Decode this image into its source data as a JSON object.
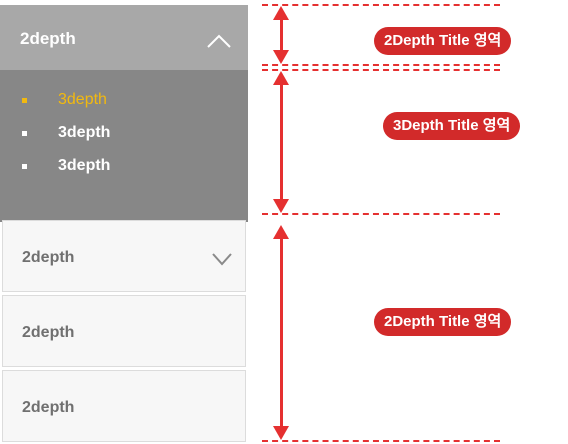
{
  "menu": {
    "active": {
      "label": "2depth",
      "expanded": true,
      "chevron_icon": "chevron-up-icon"
    },
    "subitems": [
      {
        "label": "3depth",
        "selected": true,
        "selected_color": "#f2b90f"
      },
      {
        "label": "3depth",
        "selected": false
      },
      {
        "label": "3depth",
        "selected": false
      }
    ],
    "collapsed": [
      {
        "label": "2depth",
        "chevron_icon": "chevron-down-icon",
        "has_chevron": true
      },
      {
        "label": "2depth",
        "has_chevron": false
      },
      {
        "label": "2depth",
        "has_chevron": false
      }
    ]
  },
  "annotations": {
    "top": "2Depth Title 영역",
    "middle": "3Depth Title 영역",
    "bottom": "2Depth Title 영역",
    "color": "#d22a2a"
  },
  "colors": {
    "active_header_bg": "#a8a8a8",
    "subpanel_bg": "#878787",
    "collapsed_bg": "#f7f7f7",
    "guide_color": "#e53030"
  }
}
